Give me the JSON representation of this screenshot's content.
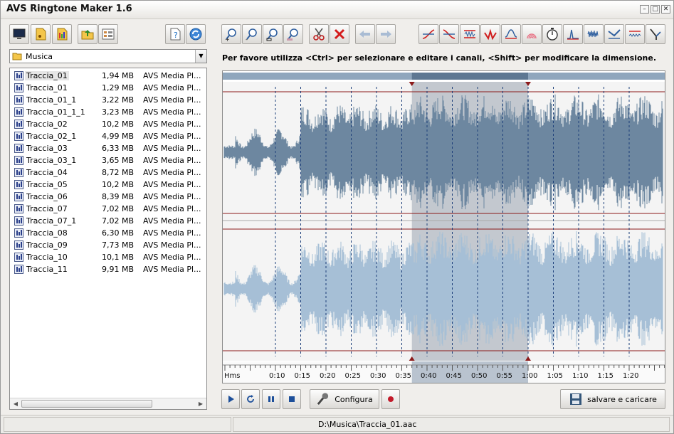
{
  "app": {
    "title": "AVS Ringtone Maker 1.6"
  },
  "folder": {
    "name": "Musica"
  },
  "files": [
    {
      "name": "Traccia_01",
      "size": "1,94 MB",
      "author": "AVS Media Pl..."
    },
    {
      "name": "Traccia_01",
      "size": "1,29 MB",
      "author": "AVS Media Pl..."
    },
    {
      "name": "Traccia_01_1",
      "size": "3,22 MB",
      "author": "AVS Media Pl..."
    },
    {
      "name": "Traccia_01_1_1",
      "size": "3,23 MB",
      "author": "AVS Media Pl..."
    },
    {
      "name": "Traccia_02",
      "size": "10,2 MB",
      "author": "AVS Media Pl..."
    },
    {
      "name": "Traccia_02_1",
      "size": "4,99 MB",
      "author": "AVS Media Pl..."
    },
    {
      "name": "Traccia_03",
      "size": "6,33 MB",
      "author": "AVS Media Pl..."
    },
    {
      "name": "Traccia_03_1",
      "size": "3,65 MB",
      "author": "AVS Media Pl..."
    },
    {
      "name": "Traccia_04",
      "size": "8,72 MB",
      "author": "AVS Media Pl..."
    },
    {
      "name": "Traccia_05",
      "size": "10,2 MB",
      "author": "AVS Media Pl..."
    },
    {
      "name": "Traccia_06",
      "size": "8,39 MB",
      "author": "AVS Media Pl..."
    },
    {
      "name": "Traccia_07",
      "size": "7,02 MB",
      "author": "AVS Media Pl..."
    },
    {
      "name": "Traccia_07_1",
      "size": "7,02 MB",
      "author": "AVS Media Pl..."
    },
    {
      "name": "Traccia_08",
      "size": "6,30 MB",
      "author": "AVS Media Pl..."
    },
    {
      "name": "Traccia_09",
      "size": "7,73 MB",
      "author": "AVS Media Pl..."
    },
    {
      "name": "Traccia_10",
      "size": "10,1 MB",
      "author": "AVS Media Pl..."
    },
    {
      "name": "Traccia_11",
      "size": "9,91 MB",
      "author": "AVS Media Pl..."
    }
  ],
  "hint": "Per favore utilizza <Ctrl> per selezionare e editare i canali, <Shift> per modificare la dimensione.",
  "timeline": {
    "unit_label": "Hms",
    "ticks": [
      "0:10",
      "0:15",
      "0:20",
      "0:25",
      "0:30",
      "0:35",
      "0:40",
      "0:45",
      "0:50",
      "0:55",
      "1:00",
      "1:05",
      "1:10",
      "1:15",
      "1:20"
    ],
    "selection_start": "0:37",
    "selection_end": "1:00"
  },
  "controls": {
    "configure_label": "Configura",
    "save_label": "salvare e caricare"
  },
  "status": {
    "path": "D:\\Musica\\Traccia_01.aac"
  },
  "colors": {
    "wave_top": "#6d87a0",
    "wave_bottom": "#a6bfd6",
    "selection": "#9aa4b0",
    "marker": "#8b1a1a"
  },
  "icons": {
    "left_toolbar": [
      "monitor-icon",
      "audio-file-icon",
      "playlist-icon",
      "folder-up-icon",
      "view-mode-icon",
      "help-icon",
      "update-icon"
    ],
    "edit_toolbar": [
      "zoom-in-icon",
      "zoom-out-icon",
      "zoom-fit-icon",
      "zoom-selection-icon",
      "cut-icon",
      "delete-icon",
      "undo-icon",
      "redo-icon"
    ],
    "effects_toolbar": [
      "fade-in-icon",
      "fade-out-icon",
      "normalize-icon",
      "amplify-icon",
      "equalizer-icon",
      "echo-icon",
      "stopwatch-icon",
      "reverb-icon",
      "noise-icon",
      "chorus-icon",
      "flanger-icon",
      "filter-icon"
    ]
  }
}
